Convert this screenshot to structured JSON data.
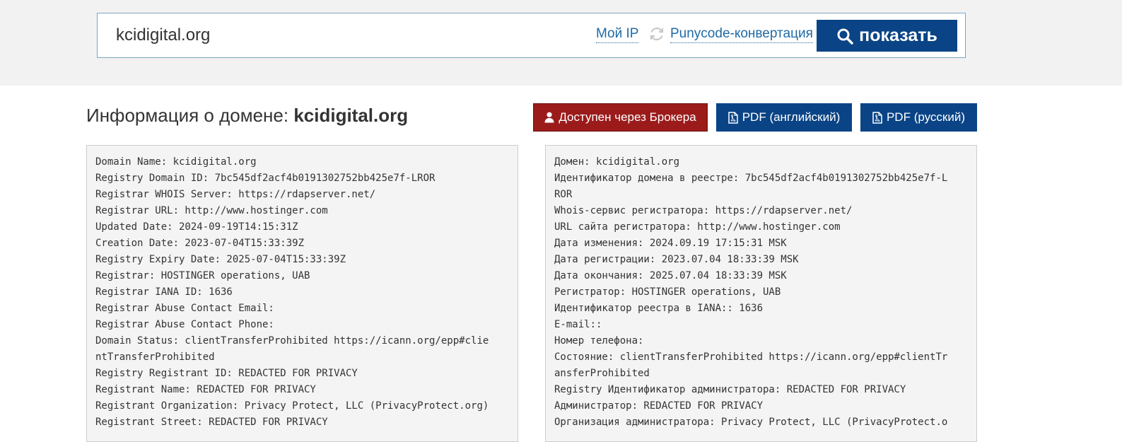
{
  "search": {
    "value": "kcidigital.org",
    "my_ip": "Мой IP",
    "punycode": "Punycode-конвертация",
    "show_button": "показать"
  },
  "page": {
    "heading_prefix": "Информация о домене: ",
    "heading_domain": "kcidigital.org"
  },
  "actions": {
    "broker": "Доступен через Брокера",
    "pdf_en": "PDF (английский)",
    "pdf_ru": "PDF (русский)"
  },
  "colors": {
    "primary": "#0a4486",
    "broker": "#9b1b1b",
    "link": "#1f6aa5"
  },
  "whois_en": [
    "Domain Name: kcidigital.org",
    "Registry Domain ID: 7bc545df2acf4b0191302752bb425e7f-LROR",
    "Registrar WHOIS Server: https://rdapserver.net/",
    "Registrar URL: http://www.hostinger.com",
    "Updated Date: 2024-09-19T14:15:31Z",
    "Creation Date: 2023-07-04T15:33:39Z",
    "Registry Expiry Date: 2025-07-04T15:33:39Z",
    "Registrar: HOSTINGER operations, UAB",
    "Registrar IANA ID: 1636",
    "Registrar Abuse Contact Email:",
    "Registrar Abuse Contact Phone:",
    "Domain Status: clientTransferProhibited https://icann.org/epp#clie",
    "ntTransferProhibited",
    "Registry Registrant ID: REDACTED FOR PRIVACY",
    "Registrant Name: REDACTED FOR PRIVACY",
    "Registrant Organization: Privacy Protect, LLC (PrivacyProtect.org)",
    "Registrant Street: REDACTED FOR PRIVACY"
  ],
  "whois_ru": [
    "Домен: kcidigital.org",
    "Идентификатор домена в реестре: 7bc545df2acf4b0191302752bb425e7f-L",
    "ROR",
    "Whois-сервис регистратора: https://rdapserver.net/",
    "URL сайта регистратора: http://www.hostinger.com",
    "Дата изменения: 2024.09.19 17:15:31 MSK",
    "Дата регистрации: 2023.07.04 18:33:39 MSK",
    "Дата окончания: 2025.07.04 18:33:39 MSK",
    "Регистратор: HOSTINGER operations, UAB",
    "Идентификатор реестра в IANA:: 1636",
    "E-mail::",
    "Номер телефона:",
    "Состояние: clientTransferProhibited https://icann.org/epp#clientTr",
    "ansferProhibited",
    "Registry Идентификатор администратора: REDACTED FOR PRIVACY",
    "Администратор: REDACTED FOR PRIVACY",
    "Организация администратора: Privacy Protect, LLC (PrivacyProtect.o"
  ]
}
